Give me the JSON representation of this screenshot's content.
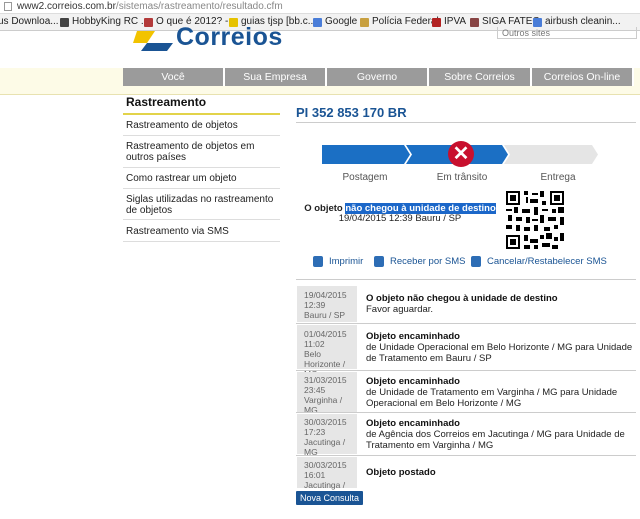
{
  "browser": {
    "url_host": "www2.correios.com.br",
    "url_path": "/sistemas/rastreamento/resultado.cfm",
    "bookmarks": [
      {
        "label": "us Downloa...",
        "icon": "download-icon",
        "color": "#3a6fb5"
      },
      {
        "label": "HobbyKing RC ...",
        "icon": "hobbyking-icon",
        "color": "#444444"
      },
      {
        "label": "O que é 2012? -...",
        "icon": "site-icon",
        "color": "#b33a3a"
      },
      {
        "label": "guias tjsp [bb.c...",
        "icon": "bank-icon",
        "color": "#e6c200"
      },
      {
        "label": "Google",
        "icon": "google-icon",
        "color": "#4a7dd8"
      },
      {
        "label": "Polícia Federal",
        "icon": "badge-icon",
        "color": "#c8a040"
      },
      {
        "label": "IPVA",
        "icon": "flag-icon",
        "color": "#b22222"
      },
      {
        "label": "SIGA FATEC",
        "icon": "book-icon",
        "color": "#884444"
      },
      {
        "label": "airbush cleanin...",
        "icon": "search-icon",
        "color": "#4a7dd8"
      }
    ]
  },
  "header": {
    "logo_text": "Correios",
    "search_placeholder": "Outros sites"
  },
  "nav": {
    "tabs": [
      "Você",
      "Sua Empresa",
      "Governo",
      "Sobre Correios",
      "Correios On-line"
    ]
  },
  "sidebar": {
    "title": "Rastreamento",
    "items": [
      "Rastreamento de objetos",
      "Rastreamento de objetos em outros países",
      "Como rastrear um objeto",
      "Siglas utilizadas no rastreamento de objetos",
      "Rastreamento via SMS"
    ]
  },
  "main": {
    "tracking_code": "PI 352 853 170 BR",
    "progress": {
      "steps": [
        "Postagem",
        "Em trânsito",
        "Entrega"
      ],
      "current_step": 2,
      "failed": true
    },
    "status": {
      "prefix": "O objeto",
      "highlight": "não chegou à unidade de destino",
      "date_place": "19/04/2015 12:39 Bauru / SP"
    },
    "actions": [
      {
        "label": "Imprimir",
        "icon": "print-icon"
      },
      {
        "label": "Receber por SMS",
        "icon": "phone-icon"
      },
      {
        "label": "Cancelar/Restabelecer SMS",
        "icon": "phone-cancel-icon"
      }
    ],
    "events": [
      {
        "date": "19/04/2015",
        "time": "12:39",
        "place": "Bauru / SP",
        "title": "O objeto não chegou à unidade de destino",
        "desc": "Favor aguardar."
      },
      {
        "date": "01/04/2015",
        "time": "11:02",
        "place": "Belo Horizonte / MG",
        "title": "Objeto encaminhado",
        "desc": "de Unidade Operacional em Belo Horizonte / MG para Unidade de Tratamento em Bauru / SP"
      },
      {
        "date": "31/03/2015",
        "time": "23:45",
        "place": "Varginha / MG",
        "title": "Objeto encaminhado",
        "desc": "de Unidade de Tratamento em Varginha / MG para Unidade Operacional em Belo Horizonte / MG"
      },
      {
        "date": "30/03/2015",
        "time": "17:23",
        "place": "Jacutinga / MG",
        "title": "Objeto encaminhado",
        "desc": "de Agência dos Correios em Jacutinga / MG para Unidade de Tratamento em Varginha / MG"
      },
      {
        "date": "30/03/2015",
        "time": "16:01",
        "place": "Jacutinga / MG",
        "title": "Objeto postado",
        "desc": ""
      }
    ],
    "new_query_label": "Nova Consulta"
  },
  "colors": {
    "brand_blue": "#1a5494",
    "step_done": "#1b6fc4",
    "step_pending": "#e5e5e5",
    "fail_red": "#c8102e",
    "nav_tab": "#9b9b9b"
  }
}
